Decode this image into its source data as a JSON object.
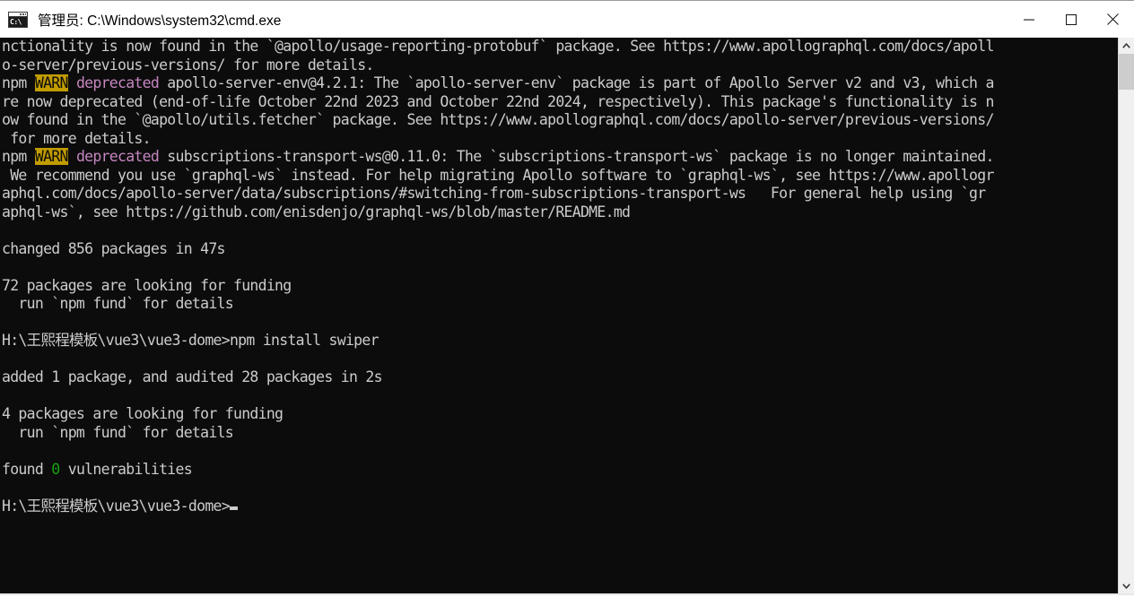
{
  "window": {
    "title": "管理员: C:\\Windows\\system32\\cmd.exe",
    "icon_label": "C:\\",
    "background_color": "#0c0c0c",
    "foreground_color": "#cccccc"
  },
  "window_controls": {
    "minimize_label": "Minimize",
    "maximize_label": "Maximize",
    "close_label": "Close"
  },
  "scrollbar": {
    "up_arrow_label": "Scroll up",
    "down_arrow_label": "Scroll down",
    "thumb_label": "Scroll thumb"
  },
  "colors": {
    "warn_background": "#c19c00",
    "warn_foreground": "#0c0c0c",
    "deprecated_magenta": "#c586c0",
    "zero_green": "#13a10e"
  },
  "terminal": {
    "prompt": "H:\\王熙程模板\\vue3\\vue3-dome>",
    "cursor": "block",
    "lines": [
      {
        "segments": [
          {
            "text": "nctionality is now found in the `@apollo/usage-reporting-protobuf` package. See https://www.apollographql.com/docs/apoll",
            "style": "default"
          }
        ]
      },
      {
        "segments": [
          {
            "text": "o-server/previous-versions/ for more details.",
            "style": "default"
          }
        ]
      },
      {
        "segments": [
          {
            "text": "npm ",
            "style": "default"
          },
          {
            "text": "WARN",
            "style": "warn"
          },
          {
            "text": " ",
            "style": "default"
          },
          {
            "text": "deprecated",
            "style": "magenta"
          },
          {
            "text": " apollo-server-env@4.2.1: The `apollo-server-env` package is part of Apollo Server v2 and v3, which a",
            "style": "default"
          }
        ]
      },
      {
        "segments": [
          {
            "text": "re now deprecated (end-of-life October 22nd 2023 and October 22nd 2024, respectively). This package's functionality is n",
            "style": "default"
          }
        ]
      },
      {
        "segments": [
          {
            "text": "ow found in the `@apollo/utils.fetcher` package. See https://www.apollographql.com/docs/apollo-server/previous-versions/",
            "style": "default"
          }
        ]
      },
      {
        "segments": [
          {
            "text": " for more details.",
            "style": "default"
          }
        ]
      },
      {
        "segments": [
          {
            "text": "npm ",
            "style": "default"
          },
          {
            "text": "WARN",
            "style": "warn"
          },
          {
            "text": " ",
            "style": "default"
          },
          {
            "text": "deprecated",
            "style": "magenta"
          },
          {
            "text": " subscriptions-transport-ws@0.11.0: The `subscriptions-transport-ws` package is no longer maintained.",
            "style": "default"
          }
        ]
      },
      {
        "segments": [
          {
            "text": " We recommend you use `graphql-ws` instead. For help migrating Apollo software to `graphql-ws`, see https://www.apollogr",
            "style": "default"
          }
        ]
      },
      {
        "segments": [
          {
            "text": "aphql.com/docs/apollo-server/data/subscriptions/#switching-from-subscriptions-transport-ws   For general help using `gr",
            "style": "default"
          }
        ]
      },
      {
        "segments": [
          {
            "text": "aphql-ws`, see https://github.com/enisdenjo/graphql-ws/blob/master/README.md",
            "style": "default"
          }
        ]
      },
      {
        "segments": []
      },
      {
        "segments": [
          {
            "text": "changed 856 packages in 47s",
            "style": "default"
          }
        ]
      },
      {
        "segments": []
      },
      {
        "segments": [
          {
            "text": "72 packages are looking for funding",
            "style": "default"
          }
        ]
      },
      {
        "segments": [
          {
            "text": "  run `npm fund` for details",
            "style": "default"
          }
        ]
      },
      {
        "segments": []
      },
      {
        "segments": [
          {
            "text": "H:\\王熙程模板\\vue3\\vue3-dome>npm install swiper",
            "style": "default"
          }
        ]
      },
      {
        "segments": []
      },
      {
        "segments": [
          {
            "text": "added 1 package, and audited 28 packages in 2s",
            "style": "default"
          }
        ]
      },
      {
        "segments": []
      },
      {
        "segments": [
          {
            "text": "4 packages are looking for funding",
            "style": "default"
          }
        ]
      },
      {
        "segments": [
          {
            "text": "  run `npm fund` for details",
            "style": "default"
          }
        ]
      },
      {
        "segments": []
      },
      {
        "segments": [
          {
            "text": "found ",
            "style": "default"
          },
          {
            "text": "0",
            "style": "green"
          },
          {
            "text": " vulnerabilities",
            "style": "default"
          }
        ]
      },
      {
        "segments": []
      },
      {
        "segments": [
          {
            "text": "H:\\王熙程模板\\vue3\\vue3-dome>",
            "style": "default"
          },
          {
            "text": "",
            "style": "cursor"
          }
        ]
      }
    ]
  }
}
